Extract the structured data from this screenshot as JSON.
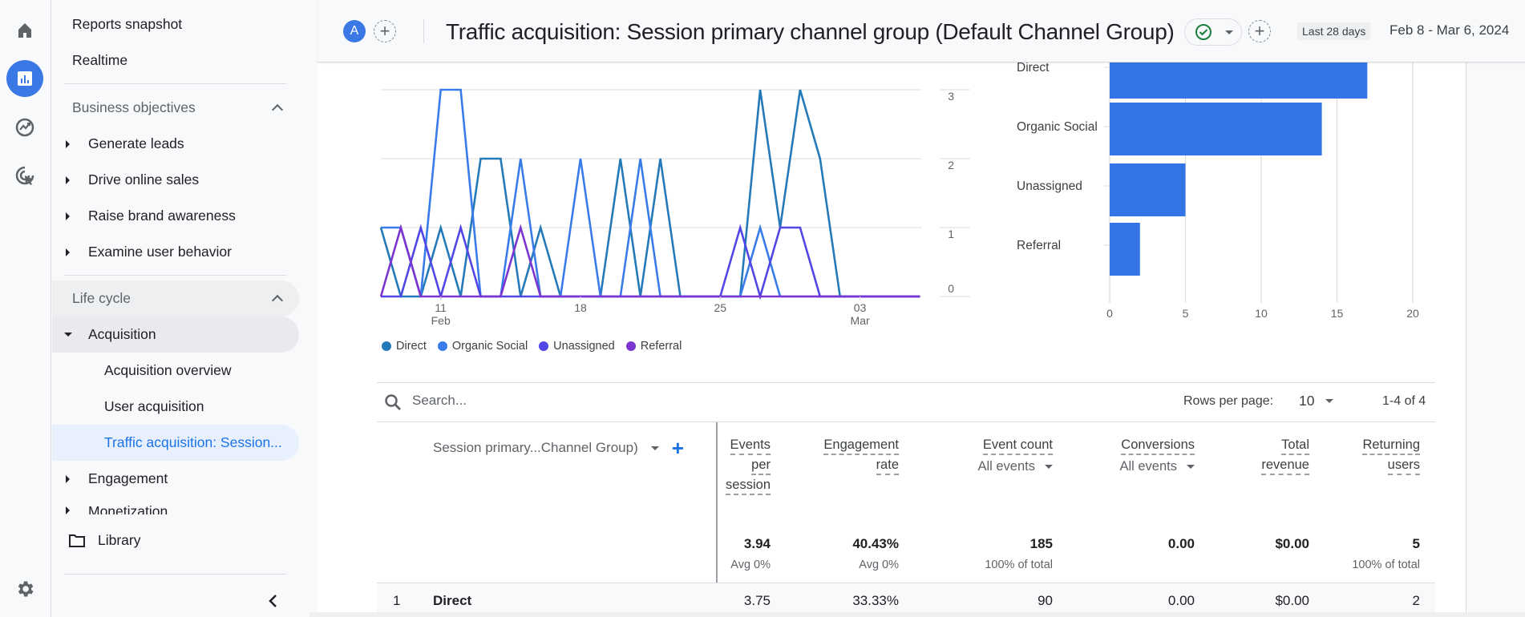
{
  "rail": {
    "items": [
      {
        "icon": "home-icon",
        "label": "Home",
        "active": false
      },
      {
        "icon": "reports-icon",
        "label": "Reports",
        "active": true
      },
      {
        "icon": "explore-icon",
        "label": "Explore",
        "active": false
      },
      {
        "icon": "advertising-icon",
        "label": "Advertising",
        "active": false
      }
    ],
    "settings_icon": "gear-icon"
  },
  "sidebar": {
    "top_items": [
      "Reports snapshot",
      "Realtime"
    ],
    "business_objectives": {
      "label": "Business objectives",
      "items": [
        "Generate leads",
        "Drive online sales",
        "Raise brand awareness",
        "Examine user behavior"
      ]
    },
    "life_cycle": {
      "label": "Life cycle",
      "acquisition": {
        "label": "Acquisition",
        "children": [
          "Acquisition overview",
          "User acquisition",
          "Traffic acquisition: Session..."
        ]
      },
      "items": [
        "Engagement",
        "Monetization"
      ]
    },
    "library_label": "Library",
    "collapse_icon": "chevron-left-icon"
  },
  "header": {
    "avatar_letter": "A",
    "title": "Traffic acquisition: Session primary channel group (Default Channel Group)",
    "date_chip": "Last 28 days",
    "date_range": "Feb 8 - Mar 6, 2024"
  },
  "colors": {
    "direct": "#2479b9",
    "organic_social": "#3a7bea",
    "unassigned": "#5146e6",
    "referral": "#7c35d0",
    "bar": "#3374e6",
    "accent": "#1a73e8"
  },
  "chart_data": [
    {
      "type": "line",
      "title": "",
      "x_start": "Feb 8",
      "x_end": "Mar 6",
      "x_ticks": [
        {
          "day_index": 3,
          "label": "11",
          "sublabel": "Feb"
        },
        {
          "day_index": 10,
          "label": "18",
          "sublabel": ""
        },
        {
          "day_index": 17,
          "label": "25",
          "sublabel": ""
        },
        {
          "day_index": 24,
          "label": "03",
          "sublabel": "Mar"
        }
      ],
      "y_ticks": [
        0,
        1,
        2,
        3
      ],
      "ylim": [
        0,
        3
      ],
      "y_axis_side": "right",
      "grid": true,
      "legend": "bottom-left",
      "series": [
        {
          "name": "Direct",
          "color_key": "direct",
          "values": [
            1,
            0,
            0,
            1,
            0,
            2,
            2,
            0,
            1,
            0,
            0,
            0,
            2,
            0,
            2,
            0,
            0,
            0,
            0,
            3,
            1,
            3,
            2,
            0,
            0,
            0,
            0,
            0
          ]
        },
        {
          "name": "Organic Social",
          "color_key": "organic_social",
          "values": [
            1,
            1,
            0,
            3,
            3,
            0,
            0,
            2,
            0,
            0,
            2,
            0,
            0,
            2,
            0,
            0,
            0,
            0,
            0,
            1,
            0,
            0,
            0,
            0,
            0,
            0,
            0,
            0
          ]
        },
        {
          "name": "Unassigned",
          "color_key": "unassigned",
          "values": [
            0,
            0,
            1,
            0,
            1,
            0,
            0,
            0,
            0,
            0,
            0,
            0,
            0,
            0,
            0,
            0,
            0,
            0,
            1,
            0,
            1,
            1,
            0,
            0,
            0,
            0,
            0,
            0
          ]
        },
        {
          "name": "Referral",
          "color_key": "referral",
          "values": [
            0,
            1,
            0,
            0,
            0,
            0,
            0,
            1,
            0,
            0,
            0,
            0,
            0,
            0,
            0,
            0,
            0,
            0,
            0,
            0,
            0,
            0,
            0,
            0,
            0,
            0,
            0,
            0
          ]
        }
      ]
    },
    {
      "type": "bar",
      "orientation": "horizontal",
      "title": "",
      "categories": [
        "Direct",
        "Organic Social",
        "Unassigned",
        "Referral"
      ],
      "values": [
        17,
        14,
        5,
        2
      ],
      "x_ticks": [
        0,
        5,
        10,
        15,
        20
      ],
      "xlim": [
        0,
        20
      ],
      "grid": true
    }
  ],
  "table": {
    "search_placeholder": "Search...",
    "rows_per_page_label": "Rows per page:",
    "rows_per_page_value": "10",
    "pagination": "1-4 of 4",
    "dimension_header": "Session primary...Channel Group)",
    "columns": [
      {
        "lines": [
          "Events",
          "per",
          "session"
        ],
        "selector": "",
        "total": "3.94",
        "total_sub": "Avg 0%"
      },
      {
        "lines": [
          "Engagement",
          "rate"
        ],
        "selector": "",
        "total": "40.43%",
        "total_sub": "Avg 0%"
      },
      {
        "lines": [
          "Event count"
        ],
        "selector": "All events",
        "total": "185",
        "total_sub": "100% of total"
      },
      {
        "lines": [
          "Conversions"
        ],
        "selector": "All events",
        "total": "0.00",
        "total_sub": ""
      },
      {
        "lines": [
          "Total",
          "revenue"
        ],
        "selector": "",
        "total": "$0.00",
        "total_sub": ""
      },
      {
        "lines": [
          "Returning",
          "users"
        ],
        "selector": "",
        "total": "5",
        "total_sub": "100% of total"
      }
    ],
    "rows": [
      {
        "index": "1",
        "channel": "Direct",
        "values": [
          "3.75",
          "33.33%",
          "90",
          "0.00",
          "$0.00",
          "2"
        ]
      }
    ]
  }
}
